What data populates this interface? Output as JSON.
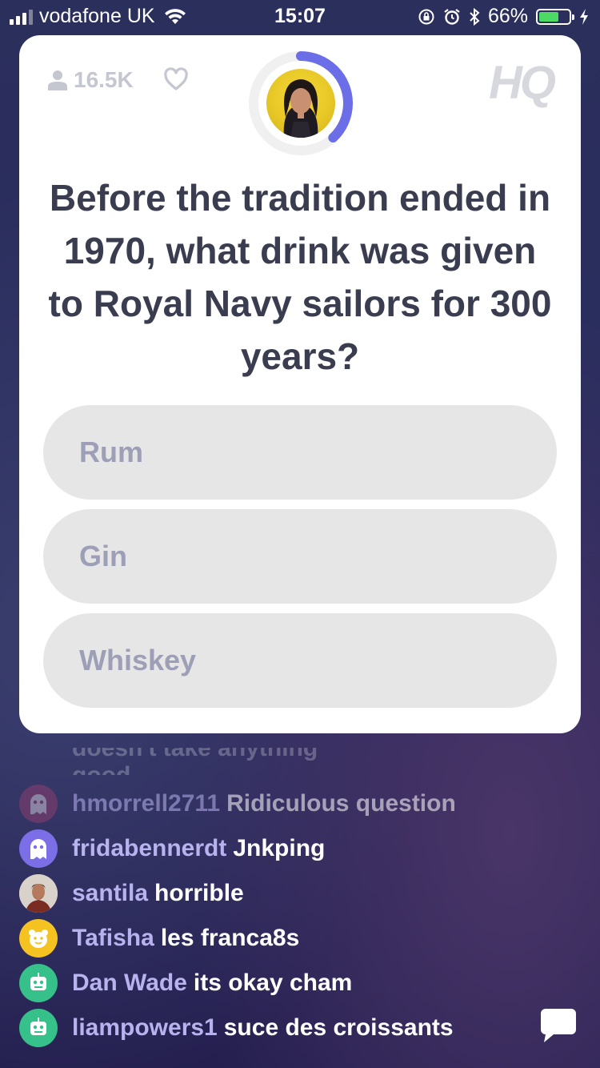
{
  "status_bar": {
    "carrier": "vodafone UK",
    "time": "15:07",
    "battery_percent": "66%",
    "battery_level": 0.66,
    "icons": [
      "signal-icon",
      "wifi-icon",
      "orientation-lock-icon",
      "alarm-icon",
      "bluetooth-icon",
      "battery-icon",
      "charging-icon"
    ]
  },
  "game": {
    "viewer_count": "16.5K",
    "logo": "HQ",
    "timer_progress": 0.38,
    "colors": {
      "timer": "#6b6ee6",
      "answer_bg": "#e6e6e6",
      "answer_text": "#9c9fb5",
      "question_text": "#3a3d4f"
    },
    "question": "Before the tradition ended in 1970, what drink was given to Royal Navy sailors for 300 years?",
    "answers": [
      {
        "label": "Rum"
      },
      {
        "label": "Gin"
      },
      {
        "label": "Whiskey"
      }
    ]
  },
  "chat": {
    "faded_text": "doesn't take anything good",
    "messages": [
      {
        "user": "hmorrell2711",
        "text": "Ridiculous question",
        "avatar": "ghost-avatar-pink"
      },
      {
        "user": "fridabennerdt",
        "text": "Jnkping",
        "avatar": "ghost-avatar-purple"
      },
      {
        "user": "santila",
        "text": "horrible",
        "avatar": "photo-avatar"
      },
      {
        "user": "Tafisha",
        "text": "les franca8s",
        "avatar": "bear-avatar-yellow"
      },
      {
        "user": "Dan Wade",
        "text": "its okay cham",
        "avatar": "robot-avatar-green"
      },
      {
        "user": "liampowers1",
        "text": "suce des croissants",
        "avatar": "robot-avatar-green"
      }
    ]
  }
}
